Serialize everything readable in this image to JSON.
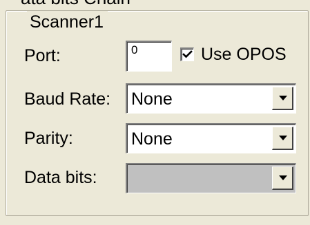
{
  "top_cut_text": "ata bits Chain",
  "group": {
    "title": "Scanner1",
    "port": {
      "label": "Port:",
      "value": "0"
    },
    "use_opos": {
      "label": "Use OPOS",
      "checked": true
    },
    "baud_rate": {
      "label": "Baud Rate:",
      "value": "None"
    },
    "parity": {
      "label": "Parity:",
      "value": "None"
    },
    "data_bits": {
      "label": "Data bits:",
      "value": "",
      "disabled": true
    }
  },
  "icons": {
    "checkbox": "checkmark-icon",
    "dropdown": "chevron-down-icon"
  }
}
